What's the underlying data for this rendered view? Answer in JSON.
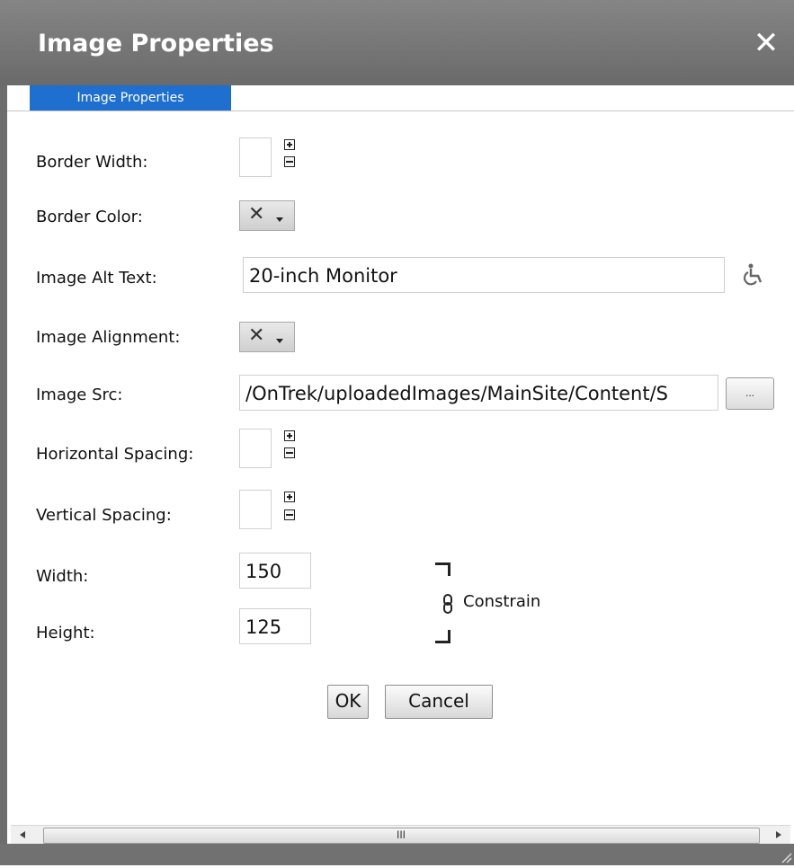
{
  "dialog": {
    "title": "Image Properties",
    "close_glyph": "✕",
    "tab_label": "Image Properties"
  },
  "fields": {
    "border_width_label": "Border Width:",
    "border_color_label": "Border Color:",
    "alt_text_label": "Image Alt Text:",
    "alt_text_value": "20-inch Monitor",
    "alignment_label": "Image Alignment:",
    "src_label": "Image Src:",
    "src_value": "/OnTrek/uploadedImages/MainSite/Content/S",
    "hspacing_label": "Horizontal Spacing:",
    "vspacing_label": "Vertical Spacing:",
    "width_label": "Width:",
    "width_value": "150",
    "height_label": "Height:",
    "height_value": "125",
    "constrain_label": "Constrain",
    "browse_label": "...",
    "accessibility_icon": "wheelchair-icon"
  },
  "buttons": {
    "ok": "OK",
    "cancel": "Cancel"
  },
  "colors": {
    "title_bar": "#6d6d6d",
    "tab_active": "#1e6fd0"
  }
}
